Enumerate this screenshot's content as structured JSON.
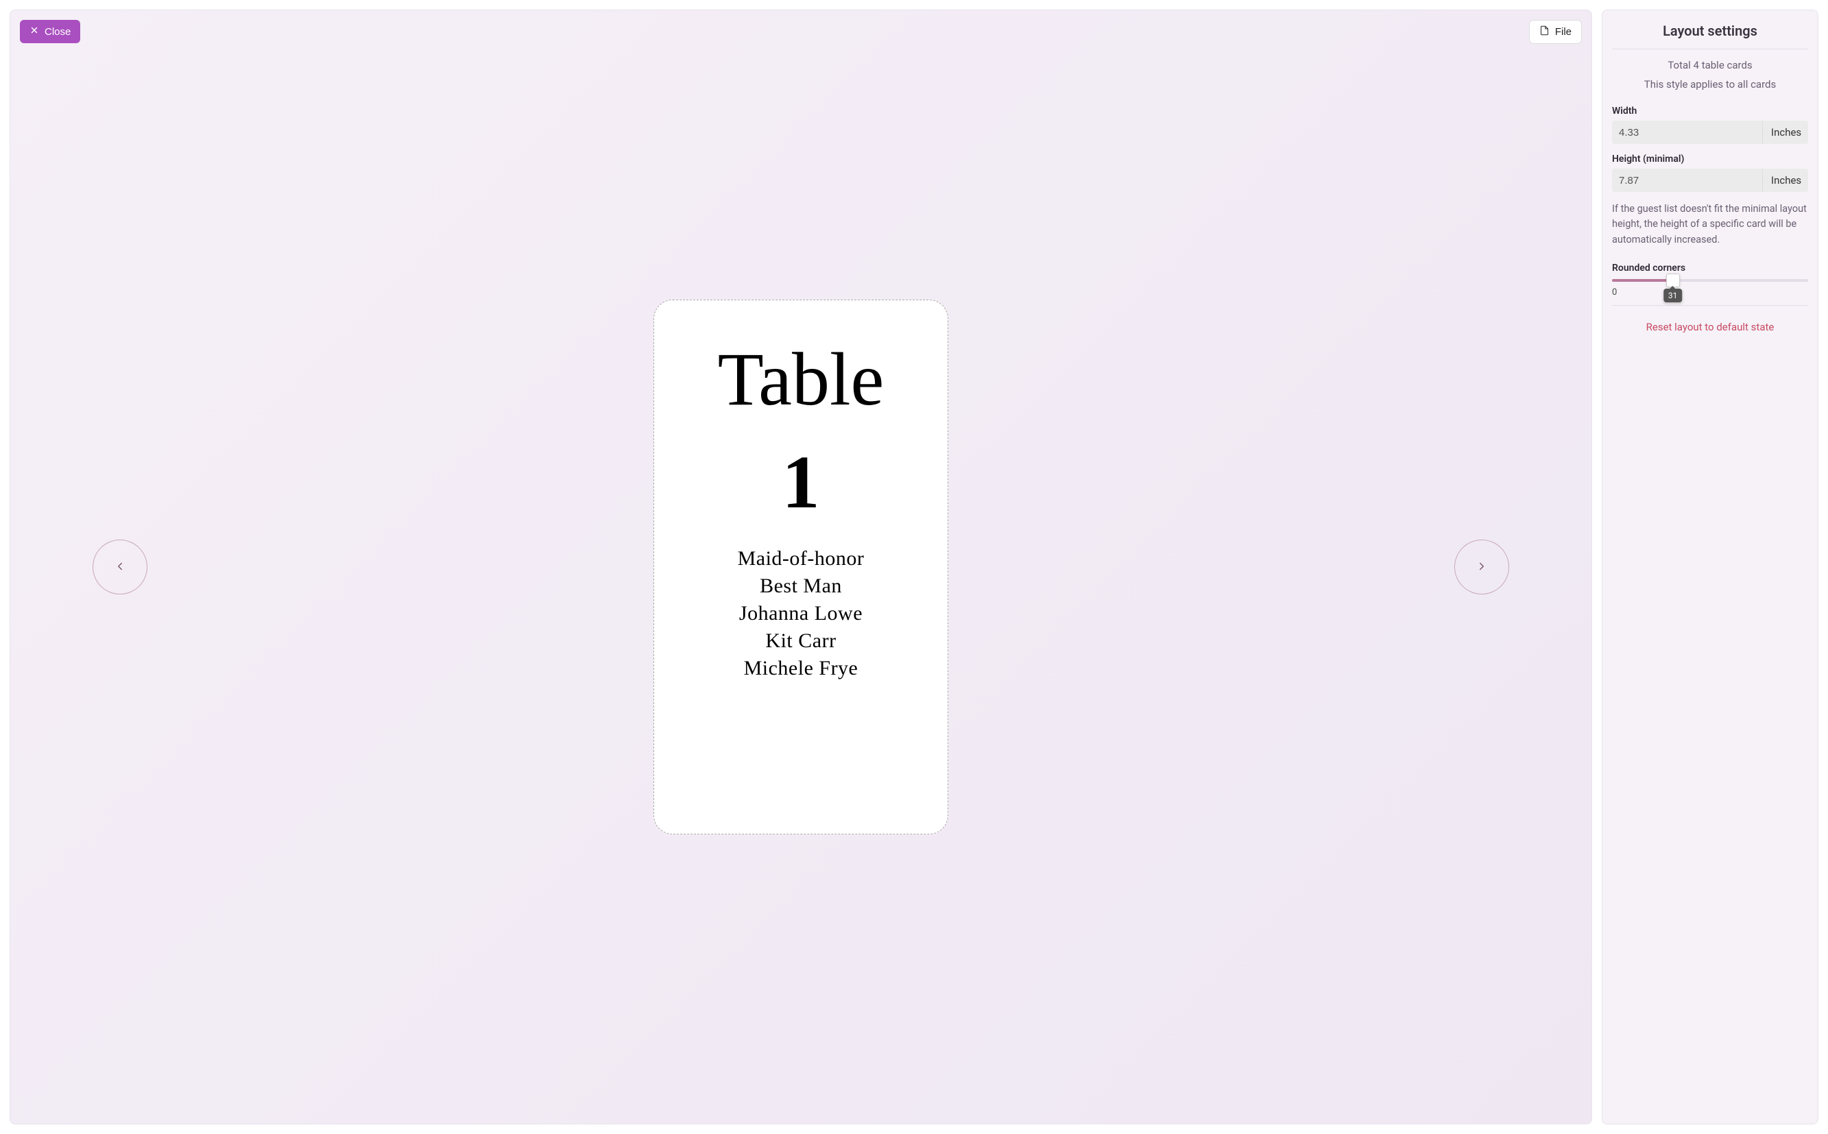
{
  "toolbar": {
    "close_label": "Close",
    "file_label": "File"
  },
  "card": {
    "title": "Table",
    "number": "1",
    "guests": [
      "Maid-of-honor",
      "Best Man",
      "Johanna Lowe",
      "Kit Carr",
      "Michele Frye"
    ]
  },
  "sidebar": {
    "title": "Layout settings",
    "total_text": "Total 4 table cards",
    "applies_text": "This style applies to all cards",
    "width_label": "Width",
    "width_value": "4.33",
    "width_unit": "Inches",
    "height_label": "Height (minimal)",
    "height_value": "7.87",
    "height_unit": "Inches",
    "note": "If the guest list doesn't fit the minimal layout height, the height of a specific card will be automatically increased.",
    "corners_label": "Rounded corners",
    "corners_value": "31",
    "corners_max": 100,
    "scale_min": "0",
    "reset_label": "Reset layout to default state"
  }
}
